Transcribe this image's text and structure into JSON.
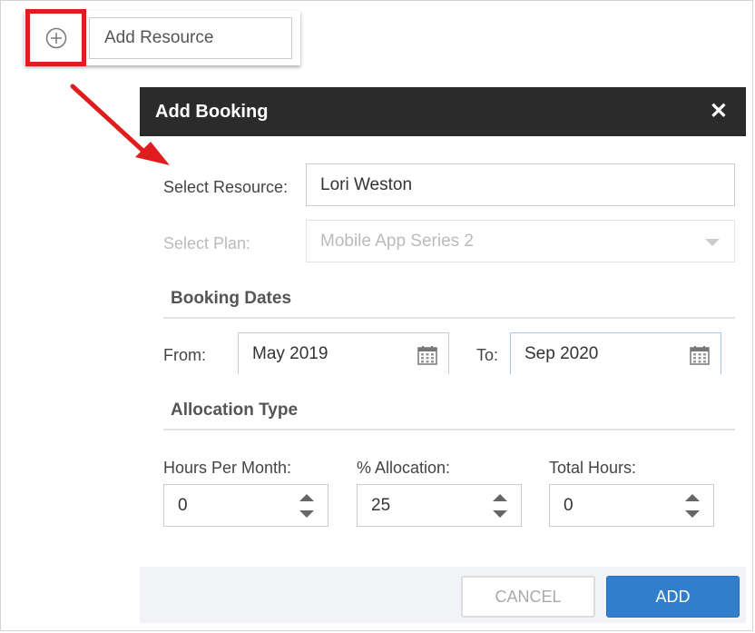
{
  "toolbar": {
    "add_resource_label": "Add Resource",
    "plus_icon": "circle-plus-icon"
  },
  "dialog": {
    "title": "Add Booking",
    "close_icon": "close-x-icon",
    "select_resource": {
      "label": "Select Resource:",
      "value": "Lori Weston"
    },
    "select_plan": {
      "label": "Select Plan:",
      "value": "Mobile App Series 2",
      "disabled": true
    },
    "booking_dates": {
      "title": "Booking Dates",
      "from_label": "From:",
      "from_value": "May 2019",
      "to_label": "To:",
      "to_value": "Sep 2020"
    },
    "allocation_type": {
      "title": "Allocation Type",
      "hours_per_month": {
        "label": "Hours Per Month:",
        "value": "0"
      },
      "percent_allocation": {
        "label": "% Allocation:",
        "value": "25"
      },
      "total_hours": {
        "label": "Total Hours:",
        "value": "0"
      }
    },
    "buttons": {
      "cancel": "CANCEL",
      "add": "ADD"
    }
  },
  "colors": {
    "highlight": "#e01d1d",
    "header_bg": "#2b2b2b",
    "primary_button": "#2f7fcc",
    "footer_bg": "#f2f3f7"
  }
}
